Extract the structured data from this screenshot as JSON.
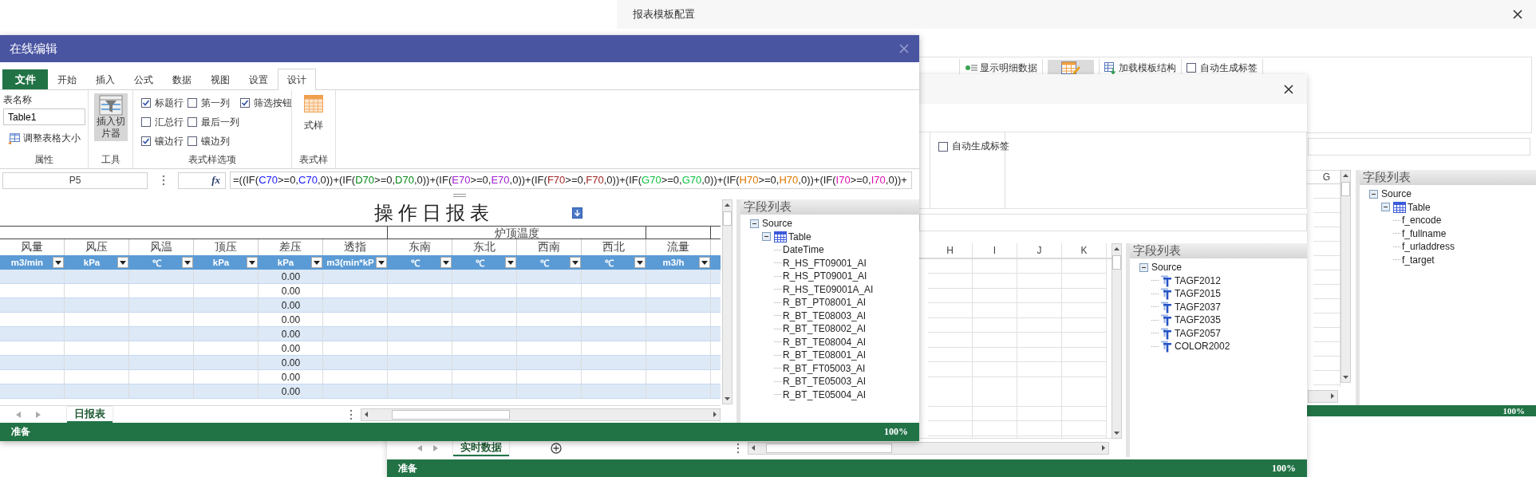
{
  "config_window": {
    "title": "报表模板配置",
    "toolbar": [
      {
        "kind": "button",
        "label": "显示明细数据"
      },
      {
        "kind": "toggle",
        "selected": true
      },
      {
        "kind": "button",
        "label": "加载模板结构"
      },
      {
        "kind": "checkbox",
        "label": "自动生成标签",
        "checked": false
      }
    ],
    "grid_columns": [
      "G"
    ],
    "field_list": {
      "title": "字段列表",
      "tree": [
        {
          "label": "Source",
          "expanded": true,
          "children": [
            {
              "label": "Table",
              "kind": "table",
              "expanded": true,
              "children": [
                {
                  "label": "f_encode"
                },
                {
                  "label": "f_fullname"
                },
                {
                  "label": "f_urladdress"
                },
                {
                  "label": "f_target"
                }
              ]
            }
          ]
        }
      ]
    },
    "status_bar": {
      "zoom": "100%"
    }
  },
  "dialog_window": {
    "option": {
      "label": "自动生成标签",
      "checked": false
    },
    "grid_columns": [
      "H",
      "I",
      "J",
      "K"
    ],
    "field_list": {
      "title": "字段列表",
      "tree": [
        {
          "label": "Source",
          "expanded": true,
          "children": [
            {
              "label": "TAGF2012",
              "kind": "text"
            },
            {
              "label": "TAGF2015",
              "kind": "text"
            },
            {
              "label": "TAGF2037",
              "kind": "text"
            },
            {
              "label": "TAGF2035",
              "kind": "text"
            },
            {
              "label": "TAGF2057",
              "kind": "text"
            },
            {
              "label": "COLOR2002",
              "kind": "text"
            }
          ]
        }
      ]
    },
    "sheet_tabs": [
      {
        "label": "实时数据",
        "selected": true
      }
    ],
    "status_bar": {
      "status": "准备",
      "zoom": "100%"
    }
  },
  "editor_window": {
    "title": "在线编辑",
    "ribbon_tabs": [
      {
        "label": "文件",
        "kind": "file",
        "selected": false
      },
      {
        "label": "开始",
        "kind": "tab",
        "selected": false
      },
      {
        "label": "插入",
        "kind": "tab",
        "selected": false
      },
      {
        "label": "公式",
        "kind": "tab",
        "selected": false
      },
      {
        "label": "数据",
        "kind": "tab",
        "selected": false
      },
      {
        "label": "视图",
        "kind": "tab",
        "selected": false
      },
      {
        "label": "设置",
        "kind": "tab",
        "selected": false
      },
      {
        "label": "设计",
        "kind": "tab",
        "selected": true
      }
    ],
    "ribbon": {
      "properties": {
        "name_label": "表名称",
        "name_value": "Table1",
        "resize_button": "调整表格大小",
        "caption": "属性"
      },
      "tools": {
        "slicer_button": "插入切片器",
        "selected": true,
        "caption": "工具"
      },
      "style_options": {
        "caption": "表式样选项",
        "options": [
          {
            "label": "标题行",
            "checked": true
          },
          {
            "label": "汇总行",
            "checked": false
          },
          {
            "label": "镶边行",
            "checked": true
          },
          {
            "label": "第一列",
            "checked": false
          },
          {
            "label": "最后一列",
            "checked": false
          },
          {
            "label": "镶边列",
            "checked": false
          },
          {
            "label": "筛选按钮",
            "checked": true
          }
        ]
      },
      "table_style": {
        "button": "式样",
        "caption": "表式样"
      }
    },
    "formula_bar": {
      "name_box": "P5",
      "function_label": "fx",
      "formula": [
        {
          "text": "=((IF("
        },
        {
          "text": "C70",
          "color": "#1a1aff"
        },
        {
          "text": ">=0,"
        },
        {
          "text": "C70",
          "color": "#1a1aff"
        },
        {
          "text": ",0))+(IF("
        },
        {
          "text": "D70",
          "color": "#0a8a1a"
        },
        {
          "text": ">=0,"
        },
        {
          "text": "D70",
          "color": "#0a8a1a"
        },
        {
          "text": ",0))+(IF("
        },
        {
          "text": "E70",
          "color": "#a020d0"
        },
        {
          "text": ">=0,"
        },
        {
          "text": "E70",
          "color": "#a020d0"
        },
        {
          "text": ",0))+(IF("
        },
        {
          "text": "F70",
          "color": "#a02828"
        },
        {
          "text": ">=0,"
        },
        {
          "text": "F70",
          "color": "#a02828"
        },
        {
          "text": ",0))+(IF("
        },
        {
          "text": "G70",
          "color": "#10c040"
        },
        {
          "text": ">=0,"
        },
        {
          "text": "G70",
          "color": "#10c040"
        },
        {
          "text": ",0))+(IF("
        },
        {
          "text": "H70",
          "color": "#e07800"
        },
        {
          "text": ">=0,"
        },
        {
          "text": "H70",
          "color": "#e07800"
        },
        {
          "text": ",0))+(IF("
        },
        {
          "text": "I70",
          "color": "#e010b0"
        },
        {
          "text": ">=0,"
        },
        {
          "text": "I70",
          "color": "#e010b0"
        },
        {
          "text": ",0))+"
        }
      ]
    },
    "sheet": {
      "title": "操 作 日 报 表",
      "columns": [
        {
          "kind": "column",
          "name": "风量",
          "unit": "m3/min"
        },
        {
          "kind": "column",
          "name": "风压",
          "unit": "kPa"
        },
        {
          "kind": "column",
          "name": "风温",
          "unit": "℃"
        },
        {
          "kind": "column",
          "name": "顶压",
          "unit": "kPa"
        },
        {
          "kind": "column",
          "name": "差压",
          "unit": "kPa"
        },
        {
          "kind": "column",
          "name": "透指",
          "unit": "m3(min*kP"
        },
        {
          "kind": "group",
          "label": "炉顶温度",
          "columns": [
            {
              "name": "东南",
              "unit": "℃"
            },
            {
              "name": "东北",
              "unit": "℃"
            },
            {
              "name": "西南",
              "unit": "℃"
            },
            {
              "name": "西北",
              "unit": "℃"
            }
          ]
        },
        {
          "kind": "column",
          "name": "流量",
          "unit": "m3/h"
        }
      ],
      "rows": [
        [
          null,
          null,
          null,
          null,
          "0.00",
          null,
          null,
          null,
          null,
          null,
          null
        ],
        [
          null,
          null,
          null,
          null,
          "0.00",
          null,
          null,
          null,
          null,
          null,
          null
        ],
        [
          null,
          null,
          null,
          null,
          "0.00",
          null,
          null,
          null,
          null,
          null,
          null
        ],
        [
          null,
          null,
          null,
          null,
          "0.00",
          null,
          null,
          null,
          null,
          null,
          null
        ],
        [
          null,
          null,
          null,
          null,
          "0.00",
          null,
          null,
          null,
          null,
          null,
          null
        ],
        [
          null,
          null,
          null,
          null,
          "0.00",
          null,
          null,
          null,
          null,
          null,
          null
        ],
        [
          null,
          null,
          null,
          null,
          "0.00",
          null,
          null,
          null,
          null,
          null,
          null
        ],
        [
          null,
          null,
          null,
          null,
          "0.00",
          null,
          null,
          null,
          null,
          null,
          null
        ],
        [
          null,
          null,
          null,
          null,
          "0.00",
          null,
          null,
          null,
          null,
          null,
          null
        ]
      ],
      "sheet_tabs": [
        {
          "label": "日报表",
          "selected": true
        }
      ]
    },
    "field_list": {
      "title": "字段列表",
      "tree": [
        {
          "label": "Source",
          "expanded": true,
          "children": [
            {
              "label": "Table",
              "kind": "table",
              "expanded": true,
              "children": [
                {
                  "label": "DateTime"
                },
                {
                  "label": "R_HS_FT09001_AI"
                },
                {
                  "label": "R_HS_PT09001_AI"
                },
                {
                  "label": "R_HS_TE09001A_AI"
                },
                {
                  "label": "R_BT_PT08001_AI"
                },
                {
                  "label": "R_BT_TE08003_AI"
                },
                {
                  "label": "R_BT_TE08002_AI"
                },
                {
                  "label": "R_BT_TE08004_AI"
                },
                {
                  "label": "R_BT_TE08001_AI"
                },
                {
                  "label": "R_BT_FT05003_AI"
                },
                {
                  "label": "R_BT_TE05003_AI"
                },
                {
                  "label": "R_BT_TE05004_AI"
                }
              ]
            }
          ]
        }
      ]
    },
    "status_bar": {
      "status": "准备",
      "zoom": "100%"
    }
  }
}
